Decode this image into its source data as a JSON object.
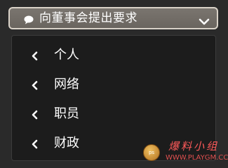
{
  "header": {
    "title": "向董事会提出要求",
    "icon": "speech-bubble-icon",
    "expand_icon": "chevron-down-icon"
  },
  "menu": {
    "items": [
      {
        "label": "个人",
        "icon": "chevron-left-icon"
      },
      {
        "label": "网络",
        "icon": "chevron-left-icon"
      },
      {
        "label": "职员",
        "icon": "chevron-left-icon"
      },
      {
        "label": "财政",
        "icon": "chevron-left-icon"
      }
    ]
  },
  "watermark": {
    "badge_text": "ps",
    "site_name": "爆料小组",
    "url": "WWW.PLAYGM.CC"
  },
  "colors": {
    "background": "#2a2a2a",
    "header_fill": "#716c66",
    "header_border": "#d9d2c8",
    "panel_fill": "#1c1c1c",
    "text": "#ffffff",
    "watermark": "#ff5a5a"
  }
}
